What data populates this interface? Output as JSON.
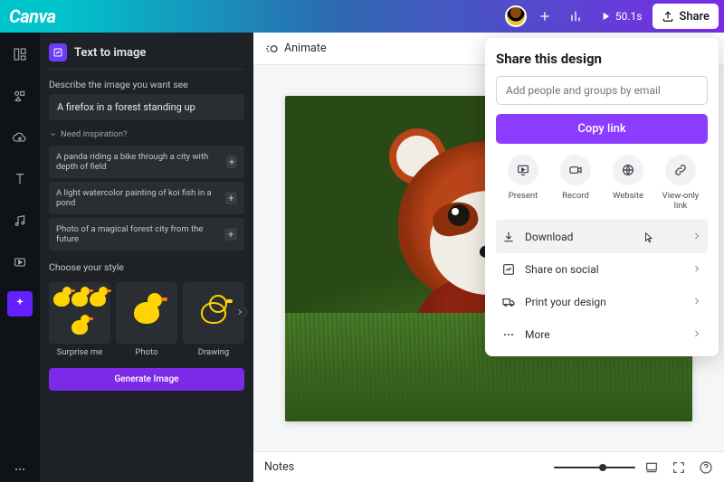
{
  "brand": "Canva",
  "header": {
    "time_label": "50.1s",
    "share_label": "Share"
  },
  "panel": {
    "title": "Text to image",
    "describe_label": "Describe the image you want see",
    "prompt": "A firefox in a forest standing up",
    "inspiration_label": "Need inspiration?",
    "suggestions": [
      "A panda riding a bike through a city with depth of field",
      "A light watercolor painting of koi fish in a pond",
      "Photo of a magical forest city from the future"
    ],
    "style_label": "Choose your style",
    "styles": [
      "Surprise me",
      "Photo",
      "Drawing"
    ],
    "generate_label": "Generate Image"
  },
  "canvas": {
    "animate_label": "Animate",
    "notes_label": "Notes"
  },
  "share": {
    "title": "Share this design",
    "input_placeholder": "Add people and groups by email",
    "copy_label": "Copy link",
    "options": [
      "Present",
      "Record",
      "Website",
      "View-only link"
    ],
    "rows": [
      "Download",
      "Share on social",
      "Print your design",
      "More"
    ]
  }
}
